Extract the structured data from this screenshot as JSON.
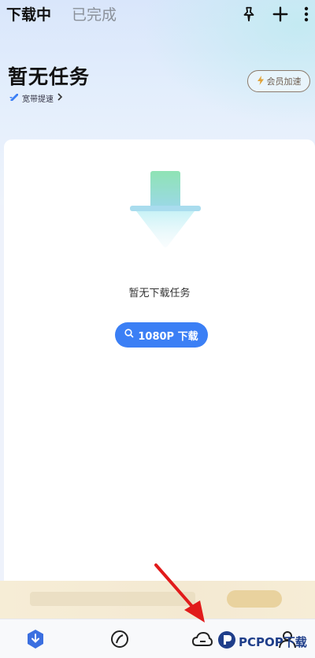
{
  "header": {
    "tabs": [
      {
        "label": "下载中",
        "active": true
      },
      {
        "label": "已完成",
        "active": false
      }
    ],
    "icons": [
      "pin-icon",
      "plus-icon",
      "more-vertical-icon"
    ]
  },
  "summary": {
    "title": "暂无任务",
    "subtitle": "宽带提速",
    "vip_button": "会员加速"
  },
  "empty_state": {
    "message": "暂无下载任务",
    "button_label": "1080P 下载"
  },
  "bottom_nav": {
    "items": [
      "download-icon",
      "discover-icon",
      "cloud-icon",
      "profile-icon"
    ]
  },
  "watermark": {
    "text": "PCPOP下载"
  },
  "colors": {
    "accent": "#3b7ff5",
    "vip_border": "#8c7a6b"
  }
}
